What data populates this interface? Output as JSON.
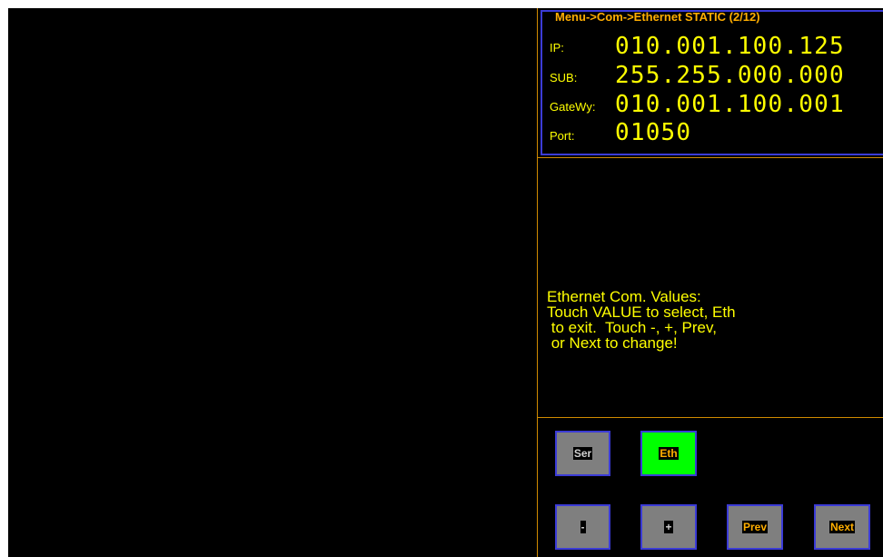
{
  "breadcrumb": "Menu->Com->Ethernet STATIC (2/12)",
  "fields": [
    {
      "label": "IP:",
      "value": "010.001.100.125"
    },
    {
      "label": "SUB:",
      "value": "255.255.000.000"
    },
    {
      "label": "GateWy:",
      "value": "010.001.100.001"
    },
    {
      "label": "Port:",
      "value": "01050"
    }
  ],
  "help_text": "Ethernet Com. Values:\nTouch VALUE to select, Eth\n to exit.  Touch -, +, Prev,\n or Next to change!",
  "buttons": {
    "ser": "Ser",
    "eth": "Eth",
    "minus": "-",
    "plus": "+",
    "prev": "Prev",
    "next": "Next"
  },
  "colors": {
    "background": "#000000",
    "text": "#ffff00",
    "accent_orange": "#ffae00",
    "border_blue": "#3b3bd6",
    "active_green": "#00ff00",
    "inactive_gray": "#7f7f7f"
  }
}
